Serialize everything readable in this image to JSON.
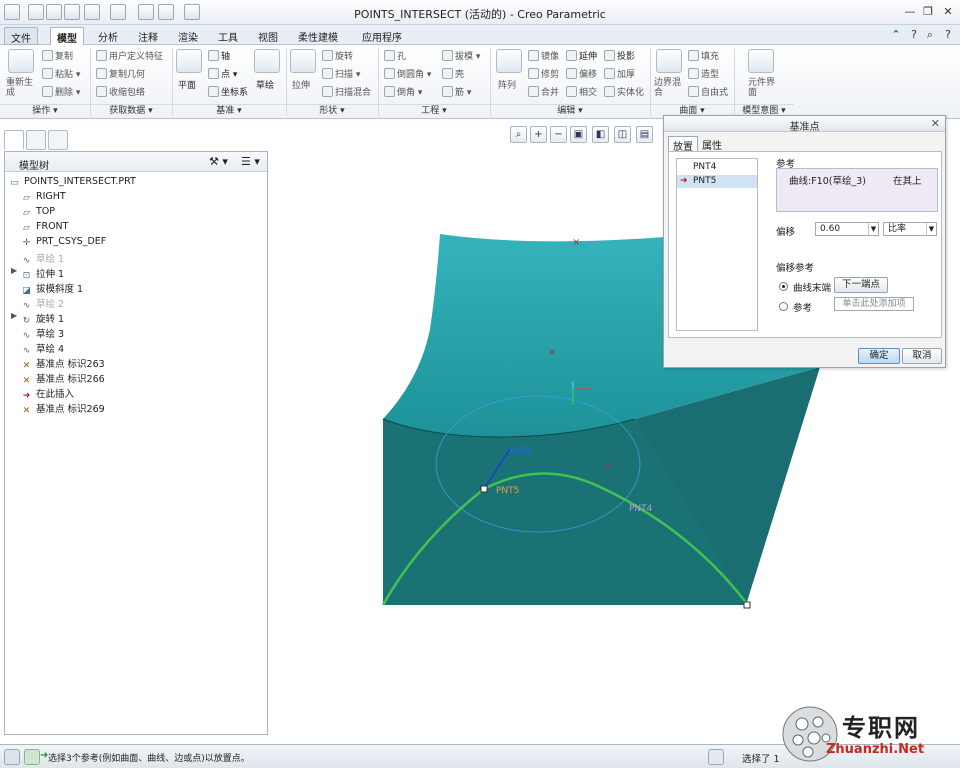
{
  "app": {
    "title": "POINTS_INTERSECT (活动的) - Creo Parametric"
  },
  "menu": {
    "file": "文件",
    "tabs": [
      "模型",
      "分析",
      "注释",
      "渲染",
      "工具",
      "视图",
      "柔性建模",
      "应用程序"
    ]
  },
  "ribbon": {
    "regenerate": "重新生成",
    "copy": "复制",
    "paste": "粘贴",
    "delete": "删除",
    "user_defined_feature": "用户定义特征",
    "copy_geometry": "复制几何",
    "shrinkwrap": "收缩包络",
    "plane": "平面",
    "axis": "轴",
    "point": "点",
    "csys": "坐标系",
    "sketch": "草绘",
    "extrude": "拉伸",
    "revolve": "旋转",
    "sweep": "扫描",
    "swept_blend": "扫描混合",
    "hole": "孔",
    "round": "倒圆角",
    "chamfer": "倒角",
    "draft": "拔模",
    "shell": "壳",
    "rib": "筋",
    "pattern": "阵列",
    "mirror": "镜像",
    "trim": "修剪",
    "merge": "合并",
    "extend": "延伸",
    "offset": "偏移",
    "intersect": "相交",
    "project": "投影",
    "thicken": "加厚",
    "solidify": "实体化",
    "boundary_blend": "边界混合",
    "fill": "填充",
    "style": "造型",
    "freestyle": "自由式",
    "component_interface": "元件界面",
    "groups": [
      "操作",
      "获取数据",
      "基准",
      "形状",
      "工程",
      "编辑",
      "曲面",
      "模型意图"
    ]
  },
  "model_tree": {
    "title": "模型树",
    "items": [
      {
        "label": "POINTS_INTERSECT.PRT",
        "dim": false,
        "icon": "part-icon"
      },
      {
        "label": "RIGHT",
        "dim": false,
        "icon": "datum-plane-icon"
      },
      {
        "label": "TOP",
        "dim": false,
        "icon": "datum-plane-icon"
      },
      {
        "label": "FRONT",
        "dim": false,
        "icon": "datum-plane-icon"
      },
      {
        "label": "PRT_CSYS_DEF",
        "dim": false,
        "icon": "csys-icon"
      },
      {
        "label": "草绘 1",
        "dim": true,
        "icon": "sketch-icon"
      },
      {
        "label": "拉伸 1",
        "dim": false,
        "icon": "extrude-icon"
      },
      {
        "label": "拔模斜度 1",
        "dim": false,
        "icon": "draft-icon"
      },
      {
        "label": "草绘 2",
        "dim": true,
        "icon": "sketch-icon"
      },
      {
        "label": "旋转 1",
        "dim": false,
        "icon": "revolve-icon"
      },
      {
        "label": "草绘 3",
        "dim": false,
        "icon": "sketch-icon"
      },
      {
        "label": "草绘 4",
        "dim": false,
        "icon": "sketch-icon"
      },
      {
        "label": "基准点 标识263",
        "dim": false,
        "icon": "datum-point-icon"
      },
      {
        "label": "基准点 标识266",
        "dim": false,
        "icon": "datum-point-icon"
      },
      {
        "label": "在此插入",
        "dim": false,
        "icon": "insert-here-icon"
      },
      {
        "label": "基准点 标识269",
        "dim": false,
        "icon": "datum-point-icon"
      }
    ]
  },
  "viewport": {
    "offset_label": "0.60",
    "pnt5_label": "PNT5",
    "pnt4_label": "PNT4"
  },
  "dialog": {
    "title": "基准点",
    "tab_placement": "放置",
    "tab_properties": "属性",
    "points": [
      "PNT4",
      "PNT5"
    ],
    "selected_point": "PNT5",
    "references_label": "参考",
    "reference_value": "曲线:F10(草绘_3)",
    "reference_type": "在其上",
    "offset_label": "偏移",
    "offset_value": "0.60",
    "offset_mode": "比率",
    "offset_ref_label": "偏移参考",
    "radio_curve_end": "曲线末端",
    "next_endpoint_button": "下一端点",
    "radio_reference": "参考",
    "click_to_add": "单击此处添加项",
    "ok_button": "确定",
    "cancel_button": "取消"
  },
  "status": {
    "message": "选择3个参考(例如曲面、曲线、边或点)以放置点。",
    "selected": "选择了 1"
  },
  "watermark": {
    "text": "专职网",
    "url": "Zhuanzhi.Net"
  },
  "colors": {
    "surface_top": "#2aa8b0",
    "surface_side": "#1b7274",
    "curve": "#3fc452",
    "accent": "#2266cc"
  }
}
